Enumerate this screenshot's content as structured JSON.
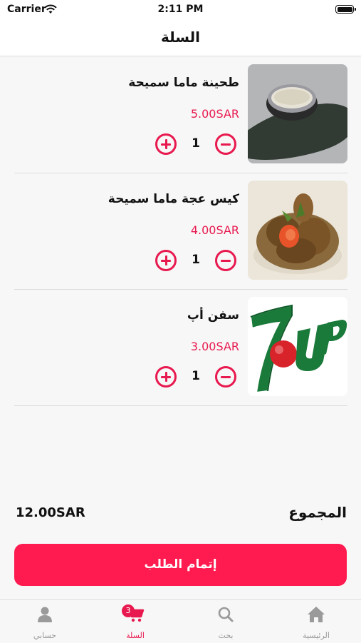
{
  "status_bar": {
    "carrier": "Carrier",
    "time": "2:11 PM"
  },
  "header": {
    "title": "السلة"
  },
  "cart": {
    "items": [
      {
        "name": "طحينة ماما سميحة",
        "price": "5.00SAR",
        "quantity": "1",
        "image": "tahini-bowl-photo"
      },
      {
        "name": "كيس عجة ماما سميحة",
        "price": "4.00SAR",
        "quantity": "1",
        "image": "fried-chicken-bowl-photo"
      },
      {
        "name": "سفن أپ",
        "price": "3.00SAR",
        "quantity": "1",
        "image": "7up-logo"
      }
    ]
  },
  "summary": {
    "total_label": "المجموع",
    "total_value": "12.00SAR"
  },
  "checkout": {
    "label": "إتمام الطلب"
  },
  "tabbar": {
    "tabs": [
      {
        "label": "حسابي",
        "icon": "person-icon"
      },
      {
        "label": "السلة",
        "icon": "cart-icon",
        "badge": "3",
        "active": true
      },
      {
        "label": "بحث",
        "icon": "search-icon"
      },
      {
        "label": "الرئيسية",
        "icon": "home-icon"
      }
    ]
  },
  "colors": {
    "accent": "#e8194f",
    "button": "#ff1a4f",
    "background": "#f7f7f7",
    "inactive": "#9a9a9a"
  }
}
